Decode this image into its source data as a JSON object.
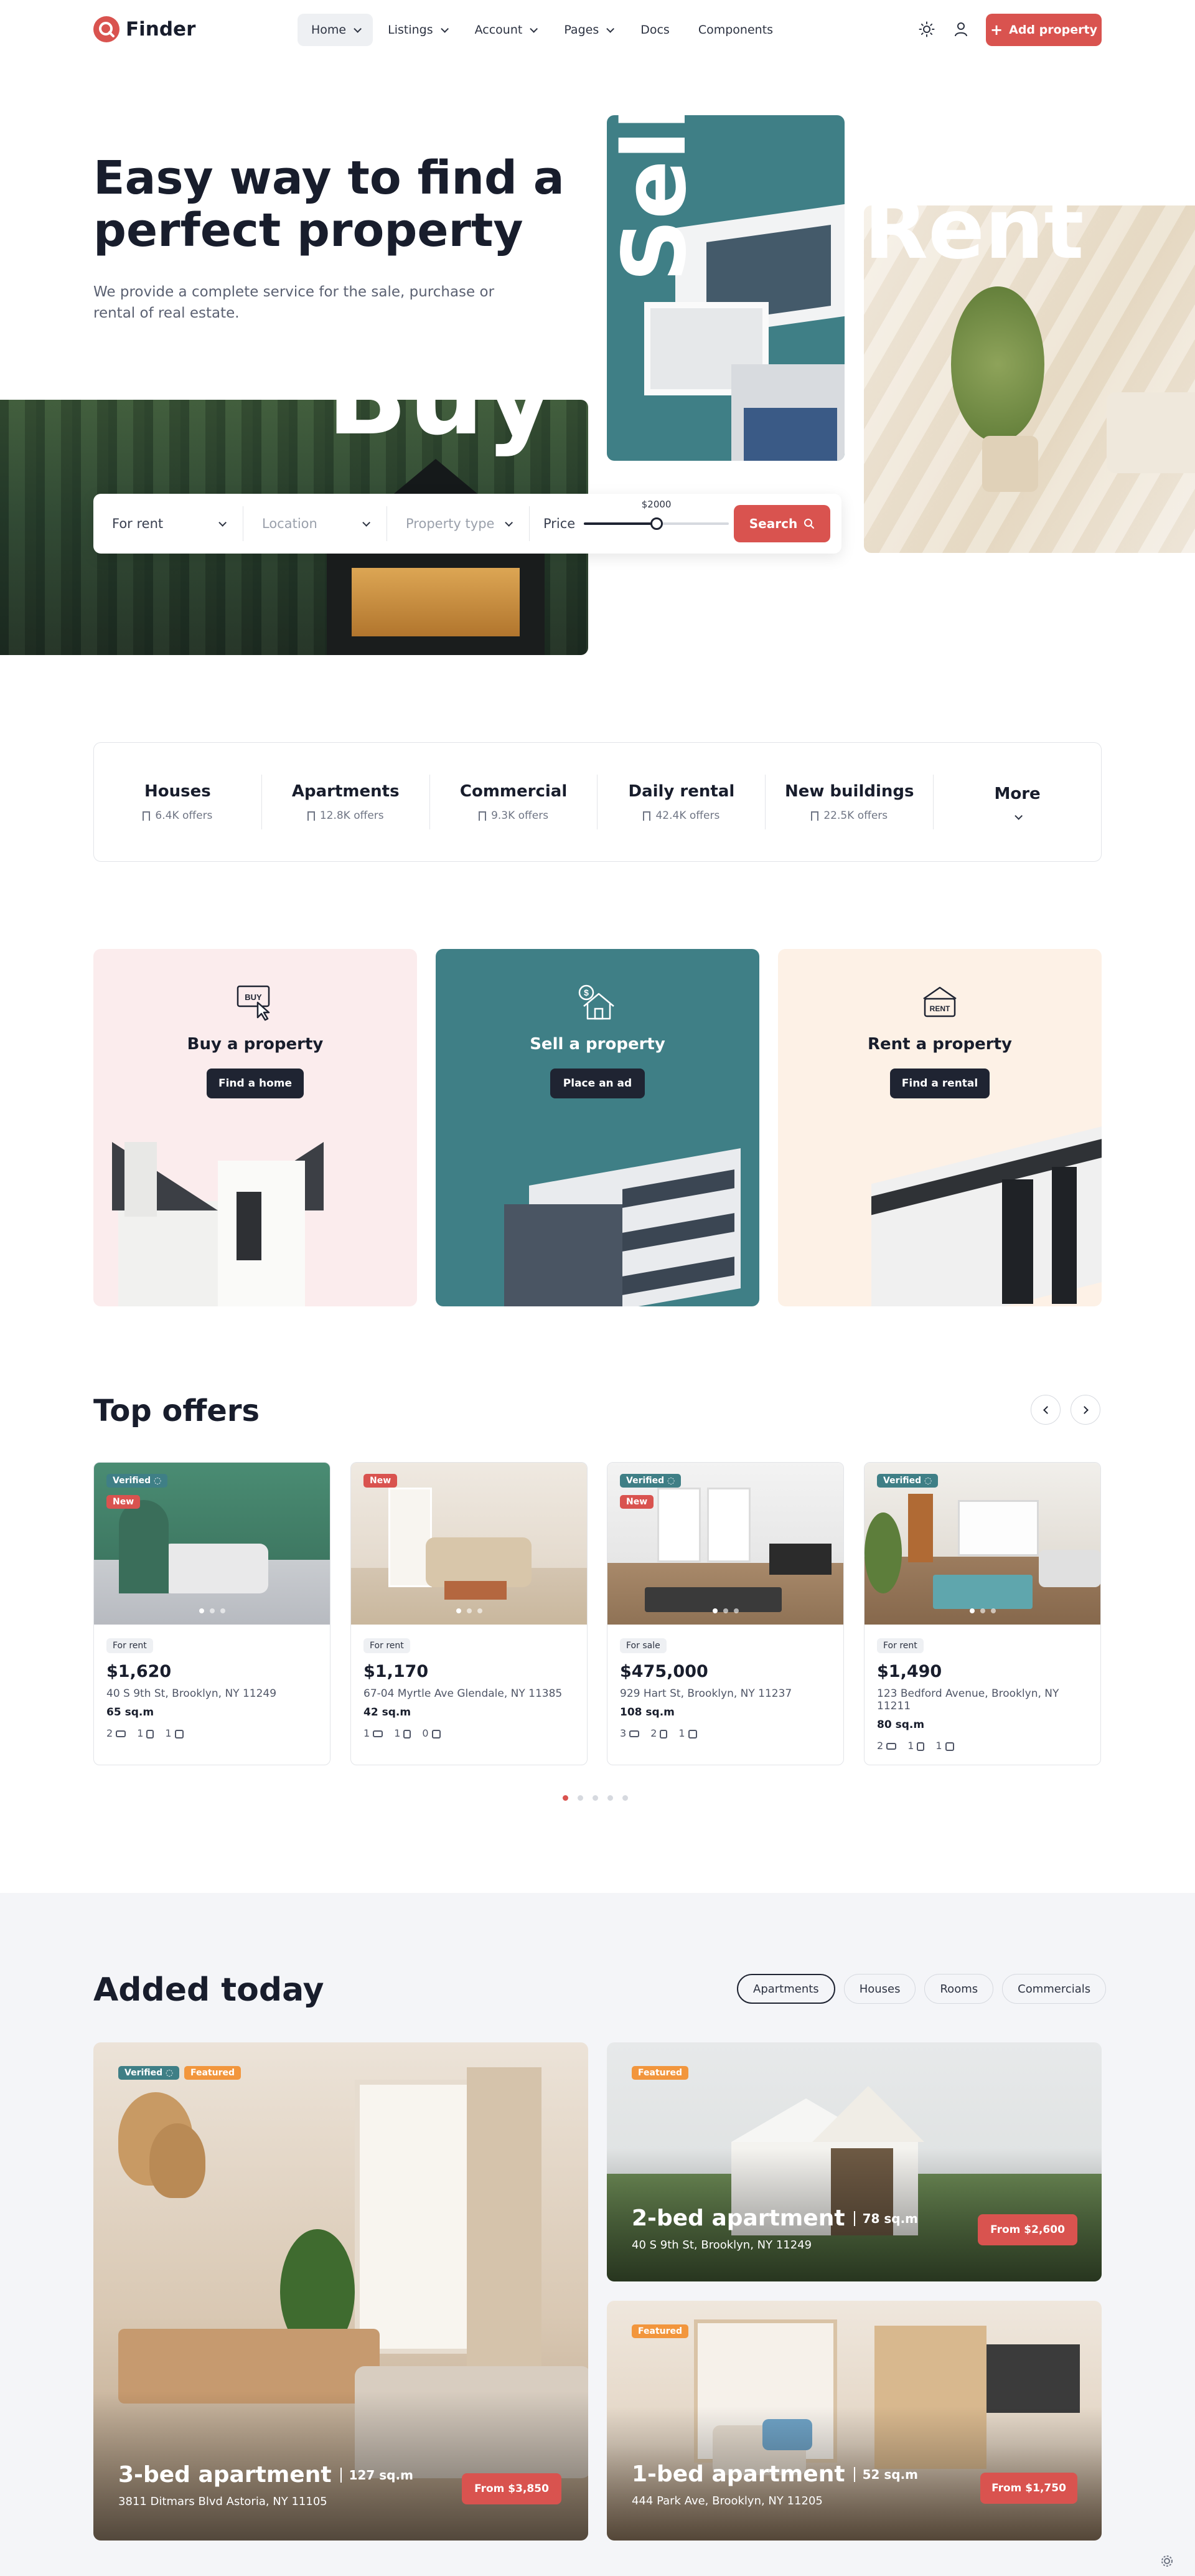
{
  "brand": {
    "name": "Finder",
    "accent": "#d9534f",
    "teal": "#3f7f86"
  },
  "header": {
    "nav": [
      {
        "label": "Home"
      },
      {
        "label": "Listings"
      },
      {
        "label": "Account"
      },
      {
        "label": "Pages"
      },
      {
        "label": "Docs"
      },
      {
        "label": "Components"
      }
    ],
    "add_property": "Add property"
  },
  "hero": {
    "title_line1": "Easy way to find a",
    "title_line2": "perfect property",
    "subtitle_line1": "We provide a complete service for the sale, purchase or",
    "subtitle_line2": "rental of real estate.",
    "word_buy": "Buy",
    "word_sell": "Sell",
    "word_rent": "Rent"
  },
  "search": {
    "type_value": "For rent",
    "location_placeholder": "Location",
    "property_type_placeholder": "Property type",
    "price_label": "Price",
    "price_value": "$2000",
    "price_fraction": 0.5,
    "button": "Search"
  },
  "categories": [
    {
      "name": "Houses",
      "count": "6.4K offers"
    },
    {
      "name": "Apartments",
      "count": "12.8K offers"
    },
    {
      "name": "Commercial",
      "count": "9.3K offers"
    },
    {
      "name": "Daily rental",
      "count": "42.4K offers"
    },
    {
      "name": "New buildings",
      "count": "22.5K offers"
    },
    {
      "name": "More",
      "count": ""
    }
  ],
  "services": [
    {
      "title": "Buy a property",
      "button": "Find a home",
      "icon_text": "BUY",
      "bg": "#fbeced"
    },
    {
      "title": "Sell a property",
      "button": "Place an ad",
      "icon_text": "$",
      "bg": "#3f7f86"
    },
    {
      "title": "Rent a property",
      "button": "Find a rental",
      "icon_text": "RENT",
      "bg": "#fdf1e6"
    }
  ],
  "top_offers": {
    "title": "Top offers",
    "items": [
      {
        "verified": "Verified",
        "new": "New",
        "type": "For rent",
        "price": "$1,620",
        "address": "40 S 9th St, Brooklyn, NY 11249",
        "area": "65 sq.m",
        "beds": "2",
        "baths": "1",
        "parking": "1"
      },
      {
        "verified": "",
        "new": "New",
        "type": "For rent",
        "price": "$1,170",
        "address": "67-04 Myrtle Ave Glendale, NY 11385",
        "area": "42 sq.m",
        "beds": "1",
        "baths": "1",
        "parking": "0"
      },
      {
        "verified": "Verified",
        "new": "New",
        "type": "For sale",
        "price": "$475,000",
        "address": "929 Hart St, Brooklyn, NY 11237",
        "area": "108 sq.m",
        "beds": "3",
        "baths": "2",
        "parking": "1"
      },
      {
        "verified": "Verified",
        "new": "",
        "type": "For rent",
        "price": "$1,490",
        "address": "123 Bedford Avenue, Brooklyn, NY 11211",
        "area": "80 sq.m",
        "beds": "2",
        "baths": "1",
        "parking": "1"
      }
    ]
  },
  "added_today": {
    "title": "Added today",
    "tabs": [
      "Apartments",
      "Houses",
      "Rooms",
      "Commercials"
    ],
    "cards": [
      {
        "verified": "Verified",
        "featured": "Featured",
        "title": "3-bed apartment",
        "area": "127 sq.m",
        "address": "3811 Ditmars Blvd Astoria, NY 11105",
        "price": "From $3,850"
      },
      {
        "verified": "",
        "featured": "Featured",
        "title": "2-bed apartment",
        "area": "78 sq.m",
        "address": "40 S 9th St, Brooklyn, NY 11249",
        "price": "From $2,600"
      },
      {
        "verified": "",
        "featured": "Featured",
        "title": "1-bed apartment",
        "area": "52 sq.m",
        "address": "444 Park Ave, Brooklyn, NY 11205",
        "price": "From $1,750"
      }
    ]
  }
}
